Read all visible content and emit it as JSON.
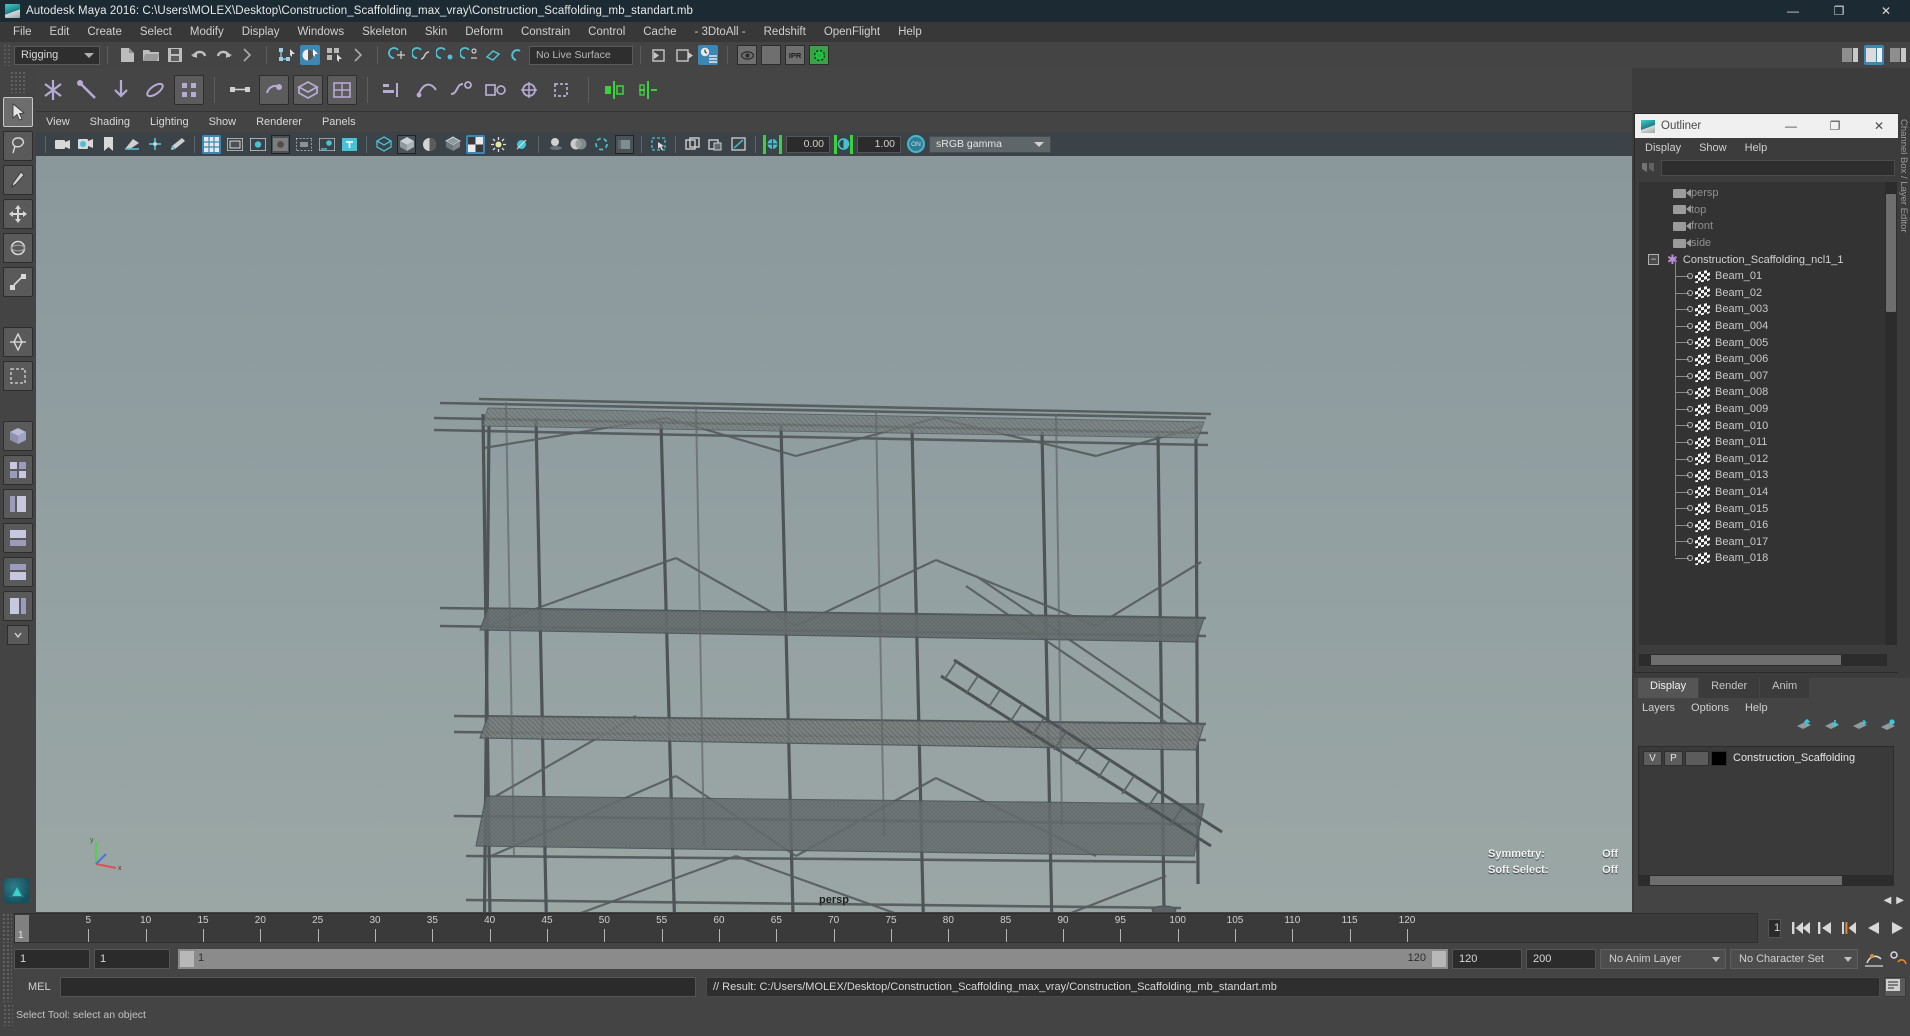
{
  "window": {
    "title": "Autodesk Maya 2016: C:\\Users\\MOLEX\\Desktop\\Construction_Scaffolding_max_vray\\Construction_Scaffolding_mb_standart.mb",
    "minimize": "—",
    "maximize": "❐",
    "close": "✕"
  },
  "menubar": {
    "items": [
      "File",
      "Edit",
      "Create",
      "Select",
      "Modify",
      "Display",
      "Windows",
      "Skeleton",
      "Skin",
      "Deform",
      "Constrain",
      "Control",
      "Cache",
      "- 3DtoAll -",
      "Redshift",
      "OpenFlight",
      "Help"
    ]
  },
  "toolbar": {
    "menu_set": "Rigging",
    "live_surface": "No Live Surface",
    "ipr_label": "IPR"
  },
  "panel": {
    "menus": [
      "View",
      "Shading",
      "Lighting",
      "Show",
      "Renderer",
      "Panels"
    ],
    "exposure": "0.00",
    "gamma": "1.00",
    "color_space": "sRGB gamma",
    "on_toggle": "ON",
    "camera_label": "persp",
    "hud": [
      {
        "label": "Symmetry:",
        "value": "Off"
      },
      {
        "label": "Soft Select:",
        "value": "Off"
      }
    ],
    "axis": {
      "x": "x",
      "y": "y",
      "z": "z"
    }
  },
  "outliner": {
    "title": "Outliner",
    "menus": [
      "Display",
      "Show",
      "Help"
    ],
    "search_value": "",
    "items": [
      {
        "label": "persp",
        "type": "camera",
        "indent": 1
      },
      {
        "label": "top",
        "type": "camera",
        "indent": 1
      },
      {
        "label": "front",
        "type": "camera",
        "indent": 1
      },
      {
        "label": "side",
        "type": "camera",
        "indent": 1
      },
      {
        "label": "Construction_Scaffolding_ncl1_1",
        "type": "group",
        "indent": 1,
        "expanded": true
      },
      {
        "label": "Beam_01",
        "type": "mesh",
        "indent": 2
      },
      {
        "label": "Beam_02",
        "type": "mesh",
        "indent": 2
      },
      {
        "label": "Beam_003",
        "type": "mesh",
        "indent": 2
      },
      {
        "label": "Beam_004",
        "type": "mesh",
        "indent": 2
      },
      {
        "label": "Beam_005",
        "type": "mesh",
        "indent": 2
      },
      {
        "label": "Beam_006",
        "type": "mesh",
        "indent": 2
      },
      {
        "label": "Beam_007",
        "type": "mesh",
        "indent": 2
      },
      {
        "label": "Beam_008",
        "type": "mesh",
        "indent": 2
      },
      {
        "label": "Beam_009",
        "type": "mesh",
        "indent": 2
      },
      {
        "label": "Beam_010",
        "type": "mesh",
        "indent": 2
      },
      {
        "label": "Beam_011",
        "type": "mesh",
        "indent": 2
      },
      {
        "label": "Beam_012",
        "type": "mesh",
        "indent": 2
      },
      {
        "label": "Beam_013",
        "type": "mesh",
        "indent": 2
      },
      {
        "label": "Beam_014",
        "type": "mesh",
        "indent": 2
      },
      {
        "label": "Beam_015",
        "type": "mesh",
        "indent": 2
      },
      {
        "label": "Beam_016",
        "type": "mesh",
        "indent": 2
      },
      {
        "label": "Beam_017",
        "type": "mesh",
        "indent": 2
      },
      {
        "label": "Beam_018",
        "type": "mesh",
        "indent": 2
      }
    ]
  },
  "channel_box": {
    "label": "Channel Box / Layer Editor"
  },
  "layer_editor": {
    "tabs": [
      "Display",
      "Render",
      "Anim"
    ],
    "active_tab": "Display",
    "menus": [
      "Layers",
      "Options",
      "Help"
    ],
    "layers": [
      {
        "visibility": "V",
        "playback": "P",
        "type": "",
        "color": "#000000",
        "name": "Construction_Scaffolding"
      }
    ]
  },
  "timeline": {
    "ticks": [
      5,
      10,
      15,
      20,
      25,
      30,
      35,
      40,
      45,
      50,
      55,
      60,
      65,
      70,
      75,
      80,
      85,
      90,
      95,
      100,
      105,
      110,
      115,
      120
    ],
    "current_frame_marker": "1",
    "current_frame": "1",
    "range_start": "1",
    "range_end": "1",
    "range_bar_start": "1",
    "range_bar_end": "120",
    "anim_end": "120",
    "playback_end": "200",
    "anim_layer": "No Anim Layer",
    "character_set": "No Character Set"
  },
  "command_line": {
    "language": "MEL",
    "input_value": "",
    "result": "// Result: C:/Users/MOLEX/Desktop/Construction_Scaffolding_max_vray/Construction_Scaffolding_mb_standart.mb"
  },
  "statusbar": {
    "text": "Select Tool: select an object"
  },
  "colors": {
    "accent_blue": "#3d87b5",
    "viewport_bg": "#93a1a3",
    "panel_bg": "#444444",
    "title_bg": "#1c2b33",
    "green_marker": "#3dd13d",
    "orange_play": "#e08a2e"
  }
}
